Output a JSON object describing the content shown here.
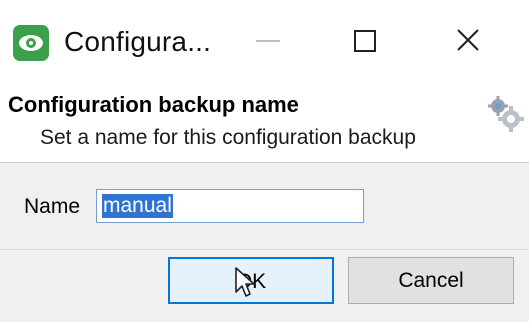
{
  "window": {
    "title": "Configura...",
    "controls": [
      "minimize",
      "maximize",
      "close"
    ]
  },
  "icons": {
    "app": "app-eye-icon",
    "minimize": "minimize-icon",
    "maximize": "maximize-icon",
    "close": "close-icon",
    "header": "gears-icon",
    "cursor": "mouse-pointer-icon"
  },
  "header": {
    "title": "Configuration backup name",
    "subtitle": "Set a name for this configuration backup"
  },
  "form": {
    "name_label": "Name",
    "name_value": "manual"
  },
  "buttons": {
    "ok": "OK",
    "cancel": "Cancel"
  },
  "colors": {
    "app_icon": "#3aa14a",
    "selection": "#2f74d0",
    "ok_border": "#0078d7"
  }
}
